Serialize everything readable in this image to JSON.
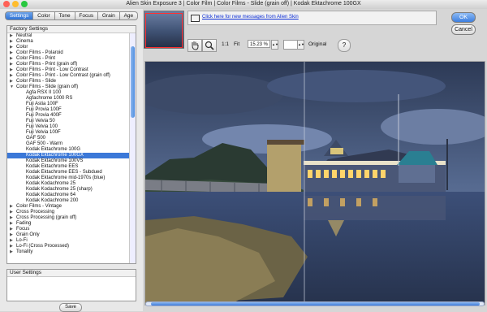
{
  "window": {
    "title": "Alien Skin Exposure 3 | Color Film | Color Films - Slide (grain off) | Kodak Ektachrome 100GX"
  },
  "tabs": [
    {
      "label": "Settings",
      "active": true
    },
    {
      "label": "Color",
      "active": false
    },
    {
      "label": "Tone",
      "active": false
    },
    {
      "label": "Focus",
      "active": false
    },
    {
      "label": "Grain",
      "active": false
    },
    {
      "label": "Age",
      "active": false
    }
  ],
  "presets": {
    "header": "Factory Settings",
    "items": [
      {
        "label": "Neutral",
        "level": 0,
        "arrow": "right",
        "selected": false
      },
      {
        "label": "Cinema",
        "level": 0,
        "arrow": "right",
        "selected": false
      },
      {
        "label": "Color",
        "level": 0,
        "arrow": "right",
        "selected": false
      },
      {
        "label": "Color Films - Polaroid",
        "level": 0,
        "arrow": "right",
        "selected": false
      },
      {
        "label": "Color Films - Print",
        "level": 0,
        "arrow": "right",
        "selected": false
      },
      {
        "label": "Color Films - Print (grain off)",
        "level": 0,
        "arrow": "right",
        "selected": false
      },
      {
        "label": "Color Films - Print - Low Contrast",
        "level": 0,
        "arrow": "right",
        "selected": false
      },
      {
        "label": "Color Films - Print - Low Contrast (grain off)",
        "level": 0,
        "arrow": "right",
        "selected": false
      },
      {
        "label": "Color Films - Slide",
        "level": 0,
        "arrow": "right",
        "selected": false
      },
      {
        "label": "Color Films - Slide (grain off)",
        "level": 0,
        "arrow": "down",
        "selected": false
      },
      {
        "label": "Agfa RSX II 100",
        "level": 1,
        "arrow": "",
        "selected": false
      },
      {
        "label": "Agfachrome 1000 RS",
        "level": 1,
        "arrow": "",
        "selected": false
      },
      {
        "label": "Fuji Astia 100F",
        "level": 1,
        "arrow": "",
        "selected": false
      },
      {
        "label": "Fuji Provia 100F",
        "level": 1,
        "arrow": "",
        "selected": false
      },
      {
        "label": "Fuji Provia 400F",
        "level": 1,
        "arrow": "",
        "selected": false
      },
      {
        "label": "Fuji Velvia 50",
        "level": 1,
        "arrow": "",
        "selected": false
      },
      {
        "label": "Fuji Velvia 100",
        "level": 1,
        "arrow": "",
        "selected": false
      },
      {
        "label": "Fuji Velvia 100F",
        "level": 1,
        "arrow": "",
        "selected": false
      },
      {
        "label": "GAF 500",
        "level": 1,
        "arrow": "",
        "selected": false
      },
      {
        "label": "GAF 500 - Warm",
        "level": 1,
        "arrow": "",
        "selected": false
      },
      {
        "label": "Kodak Ektachrome 100G",
        "level": 1,
        "arrow": "",
        "selected": false
      },
      {
        "label": "Kodak Ektachrome 100GX",
        "level": 1,
        "arrow": "",
        "selected": true
      },
      {
        "label": "Kodak Ektachrome 100VS",
        "level": 1,
        "arrow": "",
        "selected": false
      },
      {
        "label": "Kodak Ektachrome EES",
        "level": 1,
        "arrow": "",
        "selected": false
      },
      {
        "label": "Kodak Ektachrome EES - Subdued",
        "level": 1,
        "arrow": "",
        "selected": false
      },
      {
        "label": "Kodak Ektachrome mid-1970s (blue)",
        "level": 1,
        "arrow": "",
        "selected": false
      },
      {
        "label": "Kodak Kodachrome 25",
        "level": 1,
        "arrow": "",
        "selected": false
      },
      {
        "label": "Kodak Kodachrome 25 (sharp)",
        "level": 1,
        "arrow": "",
        "selected": false
      },
      {
        "label": "Kodak Kodachrome 64",
        "level": 1,
        "arrow": "",
        "selected": false
      },
      {
        "label": "Kodak Kodachrome 200",
        "level": 1,
        "arrow": "",
        "selected": false
      },
      {
        "label": "Color Films - Vintage",
        "level": 0,
        "arrow": "right",
        "selected": false
      },
      {
        "label": "Cross Processing",
        "level": 0,
        "arrow": "right",
        "selected": false
      },
      {
        "label": "Cross Processing (grain off)",
        "level": 0,
        "arrow": "right",
        "selected": false
      },
      {
        "label": "Fading",
        "level": 0,
        "arrow": "right",
        "selected": false
      },
      {
        "label": "Focus",
        "level": 0,
        "arrow": "right",
        "selected": false
      },
      {
        "label": "Grain Only",
        "level": 0,
        "arrow": "right",
        "selected": false
      },
      {
        "label": "Lo-Fi",
        "level": 0,
        "arrow": "right",
        "selected": false
      },
      {
        "label": "Lo-Fi (Cross Processed)",
        "level": 0,
        "arrow": "right",
        "selected": false
      },
      {
        "label": "Tonality",
        "level": 0,
        "arrow": "right",
        "selected": false
      }
    ]
  },
  "user_settings": {
    "header": "User Settings"
  },
  "buttons": {
    "save": "Save",
    "ok": "OK",
    "cancel": "Cancel"
  },
  "messages": {
    "link": "Click here for new messages from Alien Skin"
  },
  "toolbar": {
    "actual_size": "1:1",
    "fit": "Fit",
    "zoom_value": "15.23 %",
    "original": "Original",
    "help": "?"
  },
  "colors": {
    "selection": "#3b78d8",
    "link": "#0a2cd6",
    "ok_button": "#3d7fdf"
  }
}
